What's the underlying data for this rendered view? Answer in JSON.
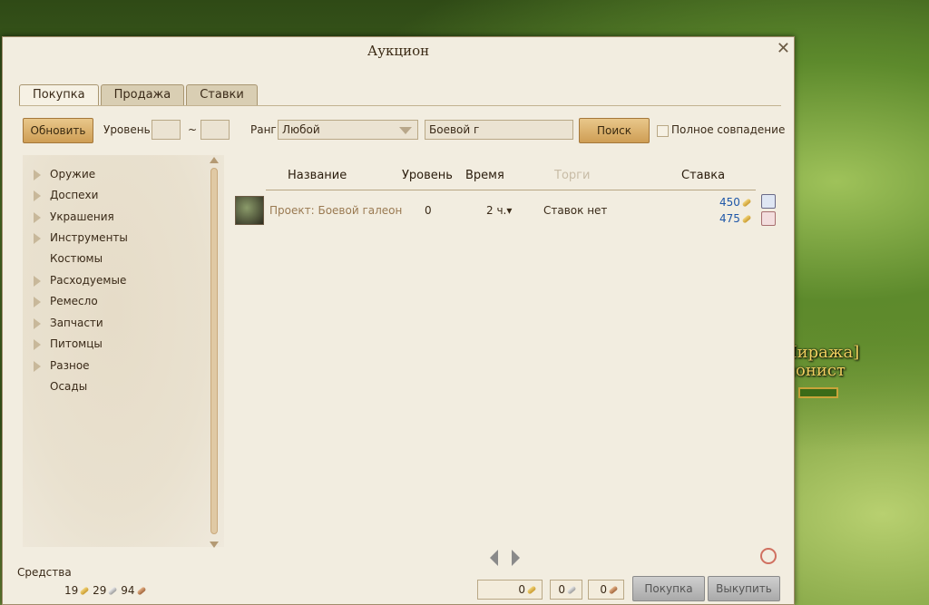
{
  "background": {
    "npc_name": "[Аук Миража]",
    "npc_title": "Аукционист"
  },
  "window": {
    "title": "Аукцион",
    "close_symbol": "✕"
  },
  "tabs": [
    {
      "label": "Покупка",
      "active": true
    },
    {
      "label": "Продажа",
      "active": false
    },
    {
      "label": "Ставки",
      "active": false
    }
  ],
  "toolbar": {
    "refresh_label": "Обновить",
    "level_label": "Уровень",
    "level_min": "",
    "level_max": "",
    "level_separator": "~",
    "grade_label": "Ранг",
    "grade_value": "Любой",
    "search_value": "Боевой г",
    "search_button": "Поиск",
    "exact_match_label": "Полное совпадение",
    "exact_match_checked": false
  },
  "categories": [
    {
      "label": "Оружие",
      "expandable": true
    },
    {
      "label": "Доспехи",
      "expandable": true
    },
    {
      "label": "Украшения",
      "expandable": true
    },
    {
      "label": "Инструменты",
      "expandable": true
    },
    {
      "label": "Костюмы",
      "expandable": false
    },
    {
      "label": "Расходуемые",
      "expandable": true
    },
    {
      "label": "Ремесло",
      "expandable": true
    },
    {
      "label": "Запчасти",
      "expandable": true
    },
    {
      "label": "Питомцы",
      "expandable": true
    },
    {
      "label": "Разное",
      "expandable": true
    },
    {
      "label": "Осады",
      "expandable": false
    }
  ],
  "columns": {
    "name": "Название",
    "level": "Уровень",
    "time": "Время",
    "bids": "Торги",
    "bid": "Ставка"
  },
  "rows": [
    {
      "name": "Проект: Боевой галеон",
      "level": "0",
      "time": "2 ч.▾",
      "bids": "Ставок нет",
      "bid_price": "450",
      "buyout_price": "475"
    }
  ],
  "funds": {
    "label": "Средства",
    "gold": "19",
    "silver": "29",
    "copper": "94"
  },
  "bottom": {
    "gold_input": "0",
    "silver_input": "0",
    "copper_input": "0",
    "buy_label": "Покупка",
    "buyout_label": "Выкупить"
  },
  "colors": {
    "gold_button": "#cf9e55",
    "price_blue": "#1f57a8",
    "item_name": "#9a7a52"
  }
}
